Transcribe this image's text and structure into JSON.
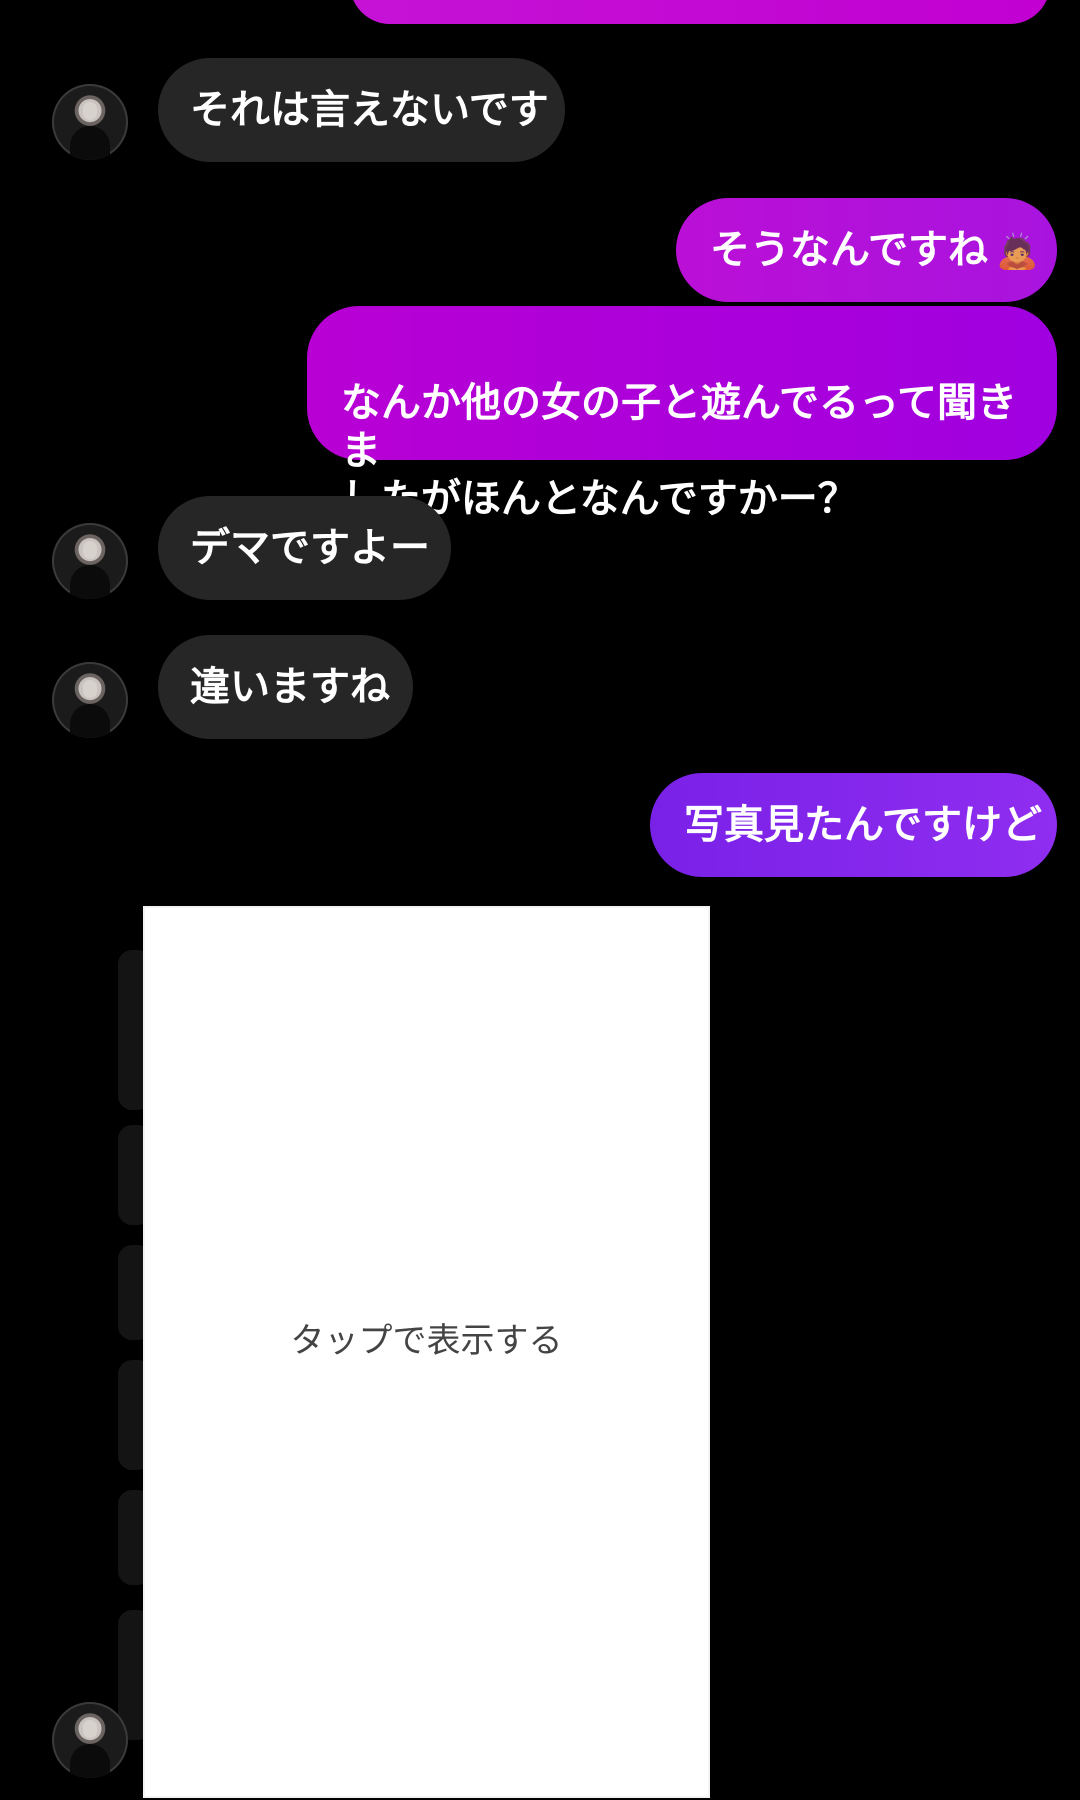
{
  "messages": [
    {
      "side": "in",
      "text": "それは言えないです"
    },
    {
      "side": "out",
      "text": "そうなんですね",
      "emoji": "🙇"
    },
    {
      "side": "out",
      "text": "なんか他の女の子と遊んでるって聞きま\nしたがほんとなんですかー？"
    },
    {
      "side": "in",
      "text": "デマですよー"
    },
    {
      "side": "in",
      "text": "違いますね"
    },
    {
      "side": "out",
      "text": "写真見たんですけど"
    }
  ],
  "media": {
    "label": "タップで表示する"
  },
  "colors": {
    "background": "#000000",
    "incoming_bubble": "#262626",
    "outgoing_bubble_magenta": "#c700d6",
    "outgoing_bubble_violet": "#8b2cf2",
    "text_primary": "#ffffff",
    "media_card": "#ffffff",
    "media_text": "#444444"
  },
  "icons": {
    "avatar": "profile-photo-avatar",
    "emoji": "bow-emoji"
  }
}
